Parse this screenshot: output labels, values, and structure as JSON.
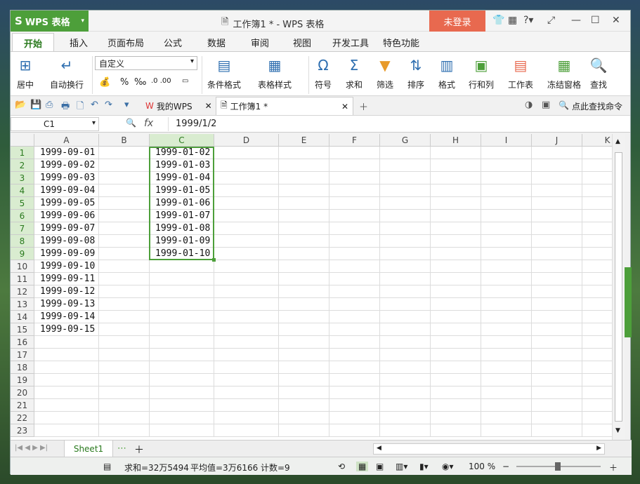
{
  "app": {
    "name": "WPS 表格",
    "window_title": "工作簿1 * - WPS 表格",
    "login": "未登录"
  },
  "tabs": [
    "开始",
    "插入",
    "页面布局",
    "公式",
    "数据",
    "审阅",
    "视图",
    "开发工具",
    "特色功能"
  ],
  "ribbon": {
    "number_format": "自定义",
    "left_buttons": [
      "居中",
      "自动换行"
    ],
    "fmt_symbols": [
      "%",
      "‰"
    ],
    "buttons": [
      "条件格式",
      "表格样式",
      "符号",
      "求和",
      "筛选",
      "排序",
      "格式",
      "行和列",
      "工作表",
      "冻结窗格",
      "查找"
    ]
  },
  "docs": {
    "home": "我的WPS",
    "current": "工作簿1 *",
    "search": "点此查找命令"
  },
  "formula_bar": {
    "cell_ref": "C1",
    "fx": "fx",
    "value": "1999/1/2"
  },
  "columns": [
    "A",
    "B",
    "C",
    "D",
    "E",
    "F",
    "G",
    "H",
    "I",
    "J",
    "K"
  ],
  "rows": [
    "1",
    "2",
    "3",
    "4",
    "5",
    "6",
    "7",
    "8",
    "9",
    "10",
    "11",
    "12",
    "13",
    "14",
    "15",
    "16",
    "17",
    "18",
    "19",
    "20",
    "21",
    "22",
    "23"
  ],
  "col_a": [
    "1999-09-01",
    "1999-09-02",
    "1999-09-03",
    "1999-09-04",
    "1999-09-05",
    "1999-09-06",
    "1999-09-07",
    "1999-09-08",
    "1999-09-09",
    "1999-09-10",
    "1999-09-11",
    "1999-09-12",
    "1999-09-13",
    "1999-09-14",
    "1999-09-15"
  ],
  "col_c": [
    "1999-01-02",
    "1999-01-03",
    "1999-01-04",
    "1999-01-05",
    "1999-01-06",
    "1999-01-07",
    "1999-01-08",
    "1999-01-09",
    "1999-01-10"
  ],
  "sheet": {
    "name": "Sheet1"
  },
  "status": {
    "sum": "求和=32万5494",
    "avg": "平均值=3万6166",
    "count": "计数=9",
    "zoom": "100 %"
  }
}
